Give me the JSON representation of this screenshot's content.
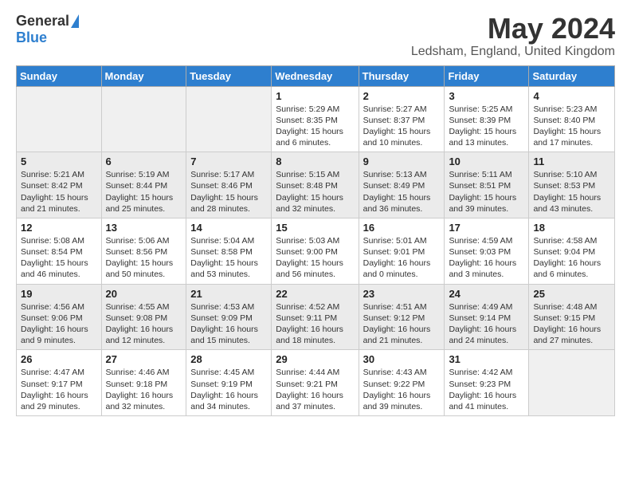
{
  "header": {
    "logo_general": "General",
    "logo_blue": "Blue",
    "month_year": "May 2024",
    "location": "Ledsham, England, United Kingdom"
  },
  "days_of_week": [
    "Sunday",
    "Monday",
    "Tuesday",
    "Wednesday",
    "Thursday",
    "Friday",
    "Saturday"
  ],
  "weeks": [
    [
      {
        "day": "",
        "info": ""
      },
      {
        "day": "",
        "info": ""
      },
      {
        "day": "",
        "info": ""
      },
      {
        "day": "1",
        "info": "Sunrise: 5:29 AM\nSunset: 8:35 PM\nDaylight: 15 hours\nand 6 minutes."
      },
      {
        "day": "2",
        "info": "Sunrise: 5:27 AM\nSunset: 8:37 PM\nDaylight: 15 hours\nand 10 minutes."
      },
      {
        "day": "3",
        "info": "Sunrise: 5:25 AM\nSunset: 8:39 PM\nDaylight: 15 hours\nand 13 minutes."
      },
      {
        "day": "4",
        "info": "Sunrise: 5:23 AM\nSunset: 8:40 PM\nDaylight: 15 hours\nand 17 minutes."
      }
    ],
    [
      {
        "day": "5",
        "info": "Sunrise: 5:21 AM\nSunset: 8:42 PM\nDaylight: 15 hours\nand 21 minutes."
      },
      {
        "day": "6",
        "info": "Sunrise: 5:19 AM\nSunset: 8:44 PM\nDaylight: 15 hours\nand 25 minutes."
      },
      {
        "day": "7",
        "info": "Sunrise: 5:17 AM\nSunset: 8:46 PM\nDaylight: 15 hours\nand 28 minutes."
      },
      {
        "day": "8",
        "info": "Sunrise: 5:15 AM\nSunset: 8:48 PM\nDaylight: 15 hours\nand 32 minutes."
      },
      {
        "day": "9",
        "info": "Sunrise: 5:13 AM\nSunset: 8:49 PM\nDaylight: 15 hours\nand 36 minutes."
      },
      {
        "day": "10",
        "info": "Sunrise: 5:11 AM\nSunset: 8:51 PM\nDaylight: 15 hours\nand 39 minutes."
      },
      {
        "day": "11",
        "info": "Sunrise: 5:10 AM\nSunset: 8:53 PM\nDaylight: 15 hours\nand 43 minutes."
      }
    ],
    [
      {
        "day": "12",
        "info": "Sunrise: 5:08 AM\nSunset: 8:54 PM\nDaylight: 15 hours\nand 46 minutes."
      },
      {
        "day": "13",
        "info": "Sunrise: 5:06 AM\nSunset: 8:56 PM\nDaylight: 15 hours\nand 50 minutes."
      },
      {
        "day": "14",
        "info": "Sunrise: 5:04 AM\nSunset: 8:58 PM\nDaylight: 15 hours\nand 53 minutes."
      },
      {
        "day": "15",
        "info": "Sunrise: 5:03 AM\nSunset: 9:00 PM\nDaylight: 15 hours\nand 56 minutes."
      },
      {
        "day": "16",
        "info": "Sunrise: 5:01 AM\nSunset: 9:01 PM\nDaylight: 16 hours\nand 0 minutes."
      },
      {
        "day": "17",
        "info": "Sunrise: 4:59 AM\nSunset: 9:03 PM\nDaylight: 16 hours\nand 3 minutes."
      },
      {
        "day": "18",
        "info": "Sunrise: 4:58 AM\nSunset: 9:04 PM\nDaylight: 16 hours\nand 6 minutes."
      }
    ],
    [
      {
        "day": "19",
        "info": "Sunrise: 4:56 AM\nSunset: 9:06 PM\nDaylight: 16 hours\nand 9 minutes."
      },
      {
        "day": "20",
        "info": "Sunrise: 4:55 AM\nSunset: 9:08 PM\nDaylight: 16 hours\nand 12 minutes."
      },
      {
        "day": "21",
        "info": "Sunrise: 4:53 AM\nSunset: 9:09 PM\nDaylight: 16 hours\nand 15 minutes."
      },
      {
        "day": "22",
        "info": "Sunrise: 4:52 AM\nSunset: 9:11 PM\nDaylight: 16 hours\nand 18 minutes."
      },
      {
        "day": "23",
        "info": "Sunrise: 4:51 AM\nSunset: 9:12 PM\nDaylight: 16 hours\nand 21 minutes."
      },
      {
        "day": "24",
        "info": "Sunrise: 4:49 AM\nSunset: 9:14 PM\nDaylight: 16 hours\nand 24 minutes."
      },
      {
        "day": "25",
        "info": "Sunrise: 4:48 AM\nSunset: 9:15 PM\nDaylight: 16 hours\nand 27 minutes."
      }
    ],
    [
      {
        "day": "26",
        "info": "Sunrise: 4:47 AM\nSunset: 9:17 PM\nDaylight: 16 hours\nand 29 minutes."
      },
      {
        "day": "27",
        "info": "Sunrise: 4:46 AM\nSunset: 9:18 PM\nDaylight: 16 hours\nand 32 minutes."
      },
      {
        "day": "28",
        "info": "Sunrise: 4:45 AM\nSunset: 9:19 PM\nDaylight: 16 hours\nand 34 minutes."
      },
      {
        "day": "29",
        "info": "Sunrise: 4:44 AM\nSunset: 9:21 PM\nDaylight: 16 hours\nand 37 minutes."
      },
      {
        "day": "30",
        "info": "Sunrise: 4:43 AM\nSunset: 9:22 PM\nDaylight: 16 hours\nand 39 minutes."
      },
      {
        "day": "31",
        "info": "Sunrise: 4:42 AM\nSunset: 9:23 PM\nDaylight: 16 hours\nand 41 minutes."
      },
      {
        "day": "",
        "info": ""
      }
    ]
  ]
}
